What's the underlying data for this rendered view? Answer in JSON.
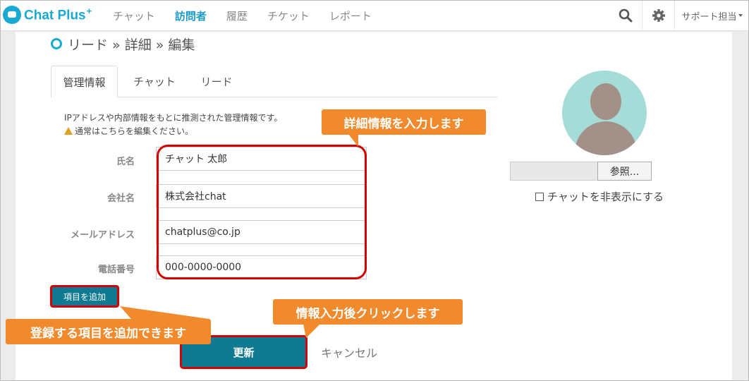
{
  "app": {
    "logo_text": "Chat Plus",
    "logo_sup": "+"
  },
  "nav": {
    "items": [
      {
        "label": "チャット",
        "active": false
      },
      {
        "label": "訪問者",
        "active": true
      },
      {
        "label": "履歴",
        "active": false
      },
      {
        "label": "チケット",
        "active": false
      },
      {
        "label": "レポート",
        "active": false
      }
    ],
    "user_label": "サポート担当",
    "search_icon": "search-icon",
    "settings_icon": "gear-icon"
  },
  "breadcrumb": "リード » 詳細 » 編集",
  "tabs": [
    {
      "label": "管理情報",
      "active": true
    },
    {
      "label": "チャット",
      "active": false
    },
    {
      "label": "リード",
      "active": false
    }
  ],
  "note": {
    "line1": "IPアドレスや内部情報をもとに推測された管理情報です。",
    "line2": "通常はこちらを編集ください。"
  },
  "form": {
    "fields": [
      {
        "label": "氏名",
        "value": "チャット 太郎"
      },
      {
        "label": "会社名",
        "value": "株式会社chat"
      },
      {
        "label": "メールアドレス",
        "value": "chatplus@co.jp"
      },
      {
        "label": "電話番号",
        "value": "000-0000-0000"
      }
    ],
    "add_button": "項目を追加",
    "update_button": "更新",
    "cancel_link": "キャンセル"
  },
  "callouts": {
    "detail": "詳細情報を入力します",
    "add": "登録する項目を追加できます",
    "update": "情報入力後クリックします"
  },
  "side": {
    "browse_button": "参照...",
    "hide_chat_label": "チャットを非表示にする"
  },
  "colors": {
    "accent": "#1aa9d3",
    "button": "#0f7a92",
    "callout": "#f08a2c",
    "highlight": "#d40000"
  }
}
